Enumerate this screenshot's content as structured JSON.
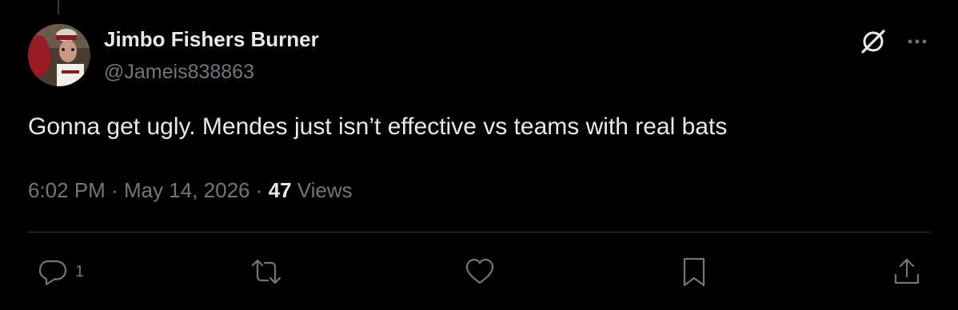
{
  "tweet": {
    "author": {
      "display_name": "Jimbo Fishers Burner",
      "handle": "@Jameis838863"
    },
    "text": "Gonna get ugly. Mendes just isn’t effective vs teams with real bats",
    "time": "6:02 PM",
    "separator": " · ",
    "date": "May 14, 2026",
    "views_count": "47",
    "views_label": " Views"
  },
  "actions": {
    "reply_count": "1",
    "retweet_count": "",
    "like_count": ""
  },
  "icons": {
    "grok": "grok-icon",
    "more": "more-icon",
    "reply": "reply-icon",
    "retweet": "retweet-icon",
    "like": "heart-icon",
    "bookmark": "bookmark-icon",
    "share": "share-icon"
  },
  "colors": {
    "background": "#000000",
    "primary_text": "#e7e9ea",
    "secondary_text": "#71767b",
    "divider": "#2f3336"
  }
}
